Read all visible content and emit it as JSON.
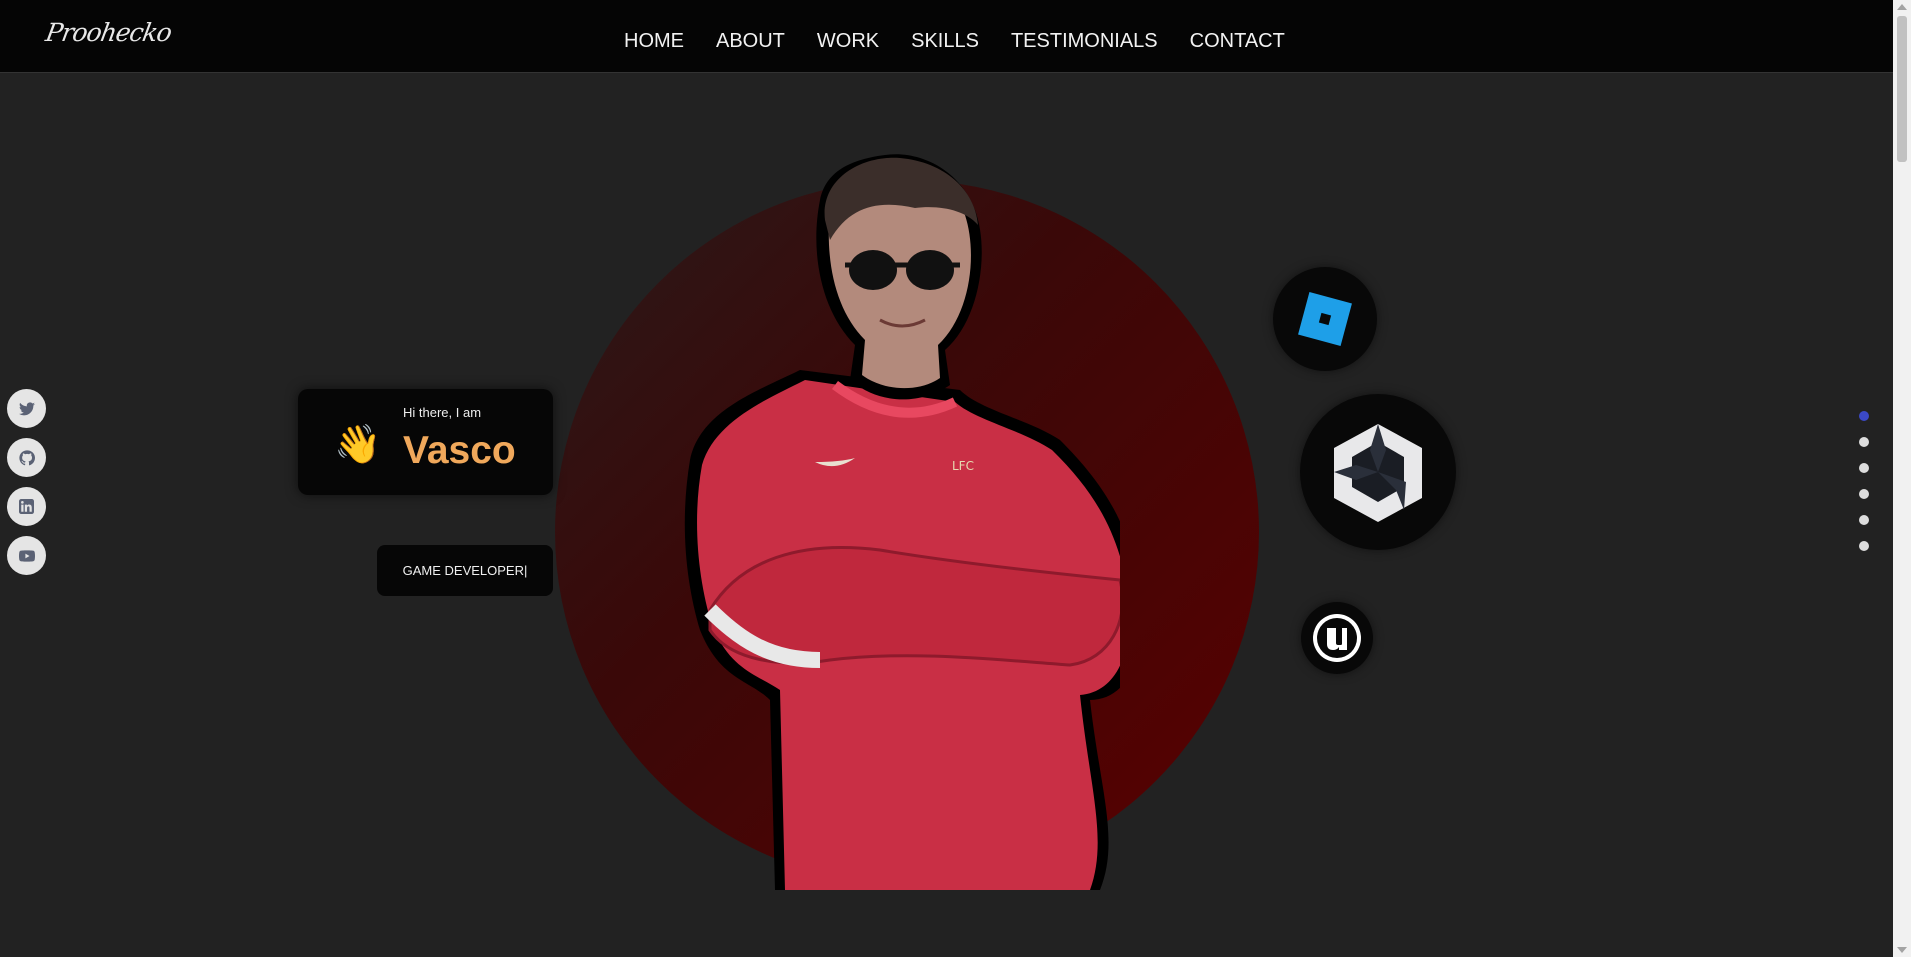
{
  "nav": {
    "logo": "Proohecko",
    "links": [
      "HOME",
      "ABOUT",
      "WORK",
      "SKILLS",
      "TESTIMONIALS",
      "CONTACT"
    ]
  },
  "socials": [
    "twitter-icon",
    "github-icon",
    "linkedin-icon",
    "youtube-icon"
  ],
  "hero": {
    "greeting": "Hi there, I am",
    "name": "Vasco",
    "role": "GAME DEVELOPER|",
    "wave_emoji": "👋"
  },
  "tech_badges": [
    "roblox-icon",
    "unity-icon",
    "unreal-icon"
  ],
  "section_dots": {
    "count": 6,
    "active_index": 0
  },
  "colors": {
    "accent_name": "#f0a85b",
    "active_dot": "#3b49c7",
    "circle_red": "#5a0000",
    "roblox_blue": "#1e9fe8"
  }
}
